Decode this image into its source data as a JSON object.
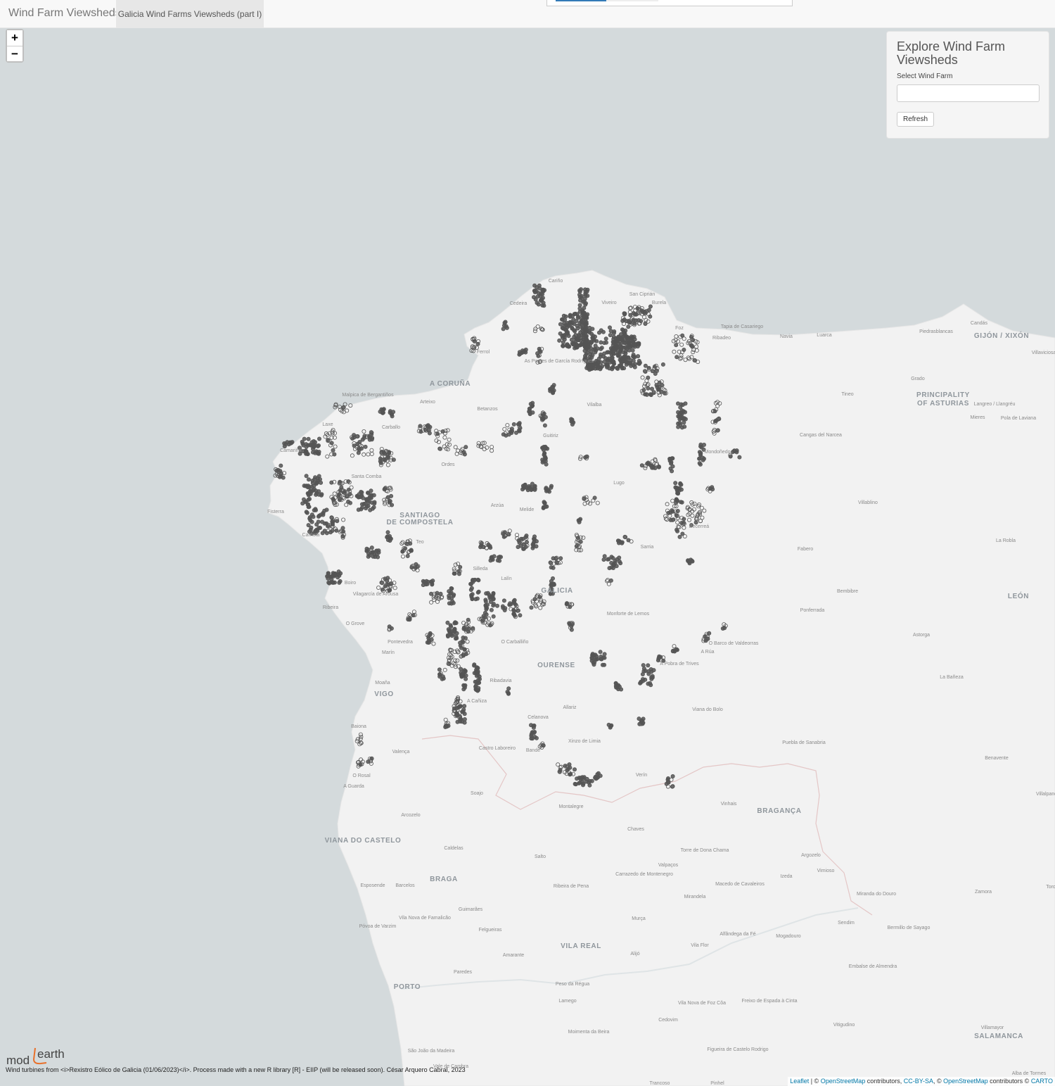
{
  "navbar": {
    "brand": "Wind Farm Viewsheds",
    "active_tab": "Galicia Wind Farms Viewsheds (part I)"
  },
  "zoom": {
    "in_label": "+",
    "out_label": "−"
  },
  "panel": {
    "title": "Explore Wind Farm Viewsheds",
    "select_label": "Select Wind Farm",
    "select_value": "",
    "refresh_label": "Refresh"
  },
  "logo": {
    "text": "mod earth"
  },
  "credit": "Wind turbines from <i>Rexistro Eólico de Galicia (01/06/2023)</i>. Process made with a new R library [R] - EIIP (will be released soon). César Arquero Cabral, 2023",
  "attribution": {
    "leaflet": "Leaflet",
    "sep1": " | © ",
    "osm1": "OpenStreetMap",
    "contrib1": " contributors, ",
    "ccbysa": "CC-BY-SA",
    "sep2": ", © ",
    "osm2": "OpenStreetMap",
    "contrib2": " contributors © ",
    "carto": "CARTO"
  },
  "colors": {
    "sea": "#d4dadc",
    "land": "#f2f2f2",
    "turbine": "#555555",
    "border": "#e4c6c6"
  },
  "map": {
    "regions": [
      {
        "name": "A CORUÑA"
      },
      {
        "name": "SANTIAGO"
      },
      {
        "name": "DE COMPOSTELA"
      },
      {
        "name": "GALICIA"
      },
      {
        "name": "OURENSE"
      },
      {
        "name": "VIGO"
      },
      {
        "name": "PORTO"
      },
      {
        "name": "BRAGA"
      },
      {
        "name": "PRINCIPALITY"
      },
      {
        "name": "OF ASTURIAS"
      },
      {
        "name": "LEÓN"
      },
      {
        "name": "BRAGANÇA"
      },
      {
        "name": "SALAMANCA"
      },
      {
        "name": "VILA REAL"
      },
      {
        "name": "GIJÓN / XIXÓN"
      },
      {
        "name": "VIANA DO CASTELO"
      }
    ],
    "places": [
      "Cariño",
      "Cedeira",
      "San Ciprián",
      "Burela",
      "Viveiro",
      "Ferrol",
      "Foz",
      "Ribadeo",
      "Tapia de Casariego",
      "Navia",
      "Luarca",
      "Candás",
      "Piedrasblancas",
      "Villaviciosa",
      "As Pontes de García Rodríguez",
      "Vilalba",
      "Malpica de Bergantiños",
      "Arteixo",
      "Betanzos",
      "Carballo",
      "Laxe",
      "Camariñas",
      "Ordes",
      "Guitiriz",
      "Grado",
      "Tineo",
      "Cangas del Narcea",
      "Langreo / Llangréu",
      "Mieres",
      "Pola de Laviana",
      "Mondoñedo",
      "Santa Comba",
      "Lugo",
      "Fisterra",
      "Arzúa",
      "Melide",
      "Villablino",
      "Carnota",
      "Becerreá",
      "Teo",
      "Sarria",
      "La Robla",
      "Fabero",
      "Silleda",
      "Lalín",
      "Boiro",
      "Vilagarcía de Arousa",
      "Bembibre",
      "Ribeira",
      "Monforte de Lemos",
      "O Grove",
      "Ponferrada",
      "Pontevedra",
      "O Carballiño",
      "Astorga",
      "O Barco de Valdeorras",
      "A Rúa",
      "Marín",
      "A Pobra de Trives",
      "Moaña",
      "Ribadavia",
      "La Bañeza",
      "A Cañiza",
      "Allariz",
      "Viana do Bolo",
      "Baiona",
      "Celanova",
      "Valença",
      "Castro Laboreiro",
      "Xinzo de Limia",
      "Puebla de Sanabria",
      "Bande",
      "Benavente",
      "O Rosal",
      "Verín",
      "A Guarda",
      "Soajo",
      "Vinhais",
      "Montalegre",
      "Arcozelo",
      "Chaves",
      "Caldelas",
      "Salto",
      "Torre de Dona Chama",
      "Argozelo",
      "Valpaços",
      "Vimioso",
      "Esposende",
      "Barcelos",
      "Carrazedo de Montenegro",
      "Izeda",
      "Ribeira de Pena",
      "Macedo de Cavaleiros",
      "Mirandela",
      "Miranda do Douro",
      "Zamora",
      "Vila Nova de Famalicão",
      "Guimarães",
      "Murça",
      "Sendim",
      "Bermillo de Sayago",
      "Póvoa de Varzim",
      "Felgueiras",
      "Alfândega da Fé",
      "Mogadouro",
      "Vila Flor",
      "Amarante",
      "Alijó",
      "Embalse de Almendra",
      "Paredes",
      "Peso da Régua",
      "Lamego",
      "Vila Nova de Foz Côa",
      "Freixo de Espada à Cinta",
      "Vitigudino",
      "Villamayor",
      "Cedovim",
      "São João da Madeira",
      "Figueira de Castelo Rodrigo",
      "Alba de Tormes",
      "Vale de Cambra",
      "Moimenta da Beira",
      "Trancoso",
      "Pinhel",
      "Villalpando",
      "Toro"
    ]
  }
}
